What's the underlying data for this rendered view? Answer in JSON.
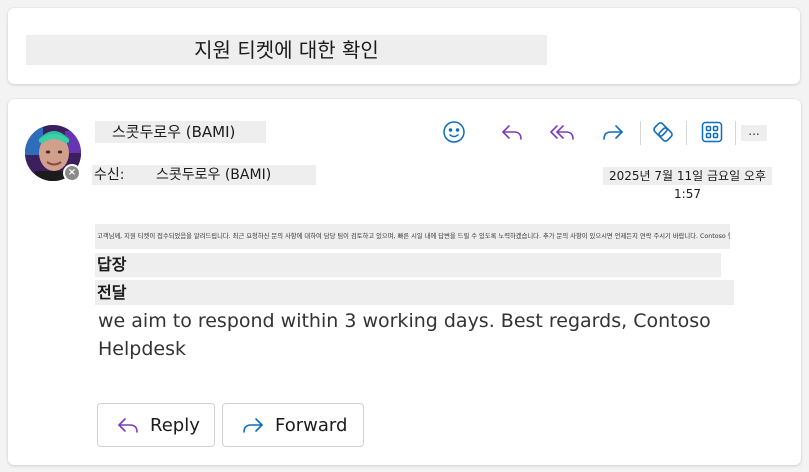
{
  "subject": "지원 티켓에 대한 확인",
  "message": {
    "sender": "스콧두로우 (BAMI)",
    "to_label": "수신:",
    "to_name": "스콧두로우 (BAMI)",
    "date": "2025년 7월 11일 금요일 오후 1:57",
    "body_small": "고객님께, 지원 티켓이 접수되었음을 알려드립니다. 최근 요청하신 문의 사항에 대하여 담당 팀이 검토하고 있으며, 빠른 시일 내에 답변을 드릴 수 있도록 노력하겠습니다. 추가 문의 사항이 있으시면 언제든지 연락 주시기 바랍니다. Contoso 헬프데스크",
    "reply_line": "답장",
    "forward_line": "전달",
    "body_text": "we aim to respond within 3 working days. Best regards, Contoso Helpdesk"
  },
  "toolbar": {
    "icons": [
      "emoji-icon",
      "reply-icon",
      "reply-all-icon",
      "forward-icon",
      "loop-icon",
      "apps-icon"
    ],
    "more_label": "..."
  },
  "actions": {
    "reply_label": "Reply",
    "forward_label": "Forward"
  },
  "colors": {
    "accent": "#0f6cbd",
    "reply_accent": "#7a3dbf",
    "highlight": "#eeeeee"
  }
}
